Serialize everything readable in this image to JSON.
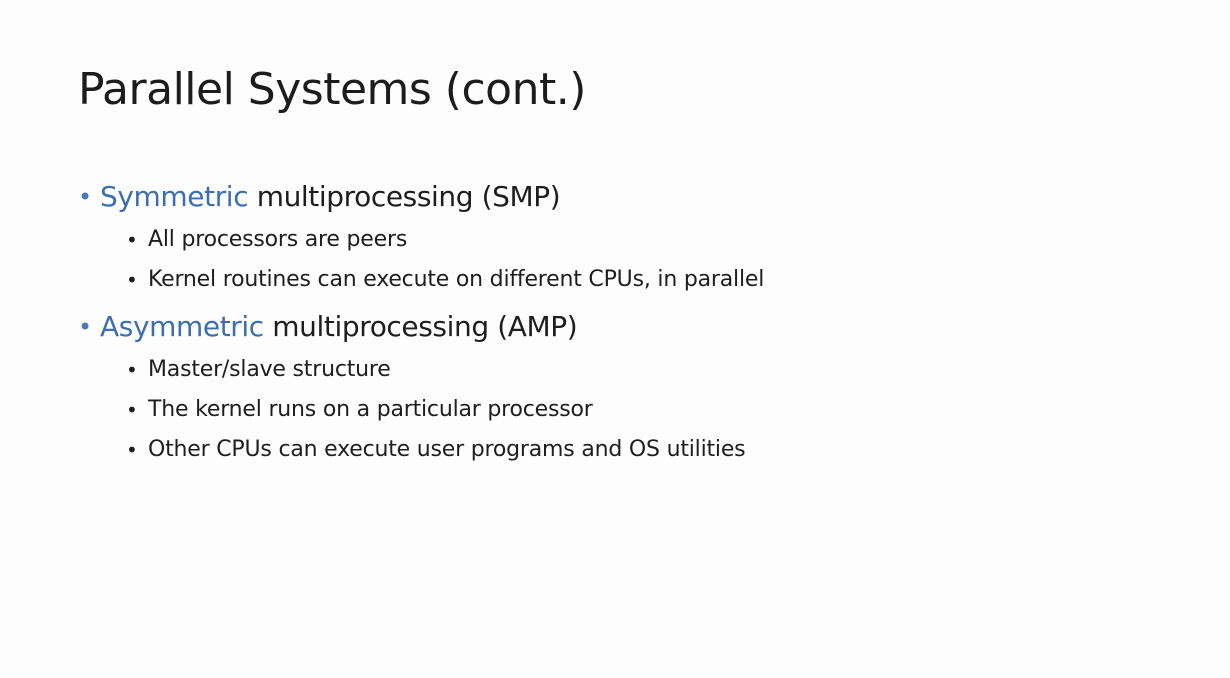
{
  "slide": {
    "title": "Parallel Systems (cont.)",
    "bullet_char": "•",
    "accent_color": "#3c6fae",
    "items": [
      {
        "highlight": "Symmetric",
        "rest": " multiprocessing (SMP)",
        "subitems": [
          "All processors are peers",
          "Kernel routines can execute on different CPUs, in parallel"
        ]
      },
      {
        "highlight": "Asymmetric",
        "rest": " multiprocessing (AMP)",
        "subitems": [
          "Master/slave structure",
          "The kernel runs on a particular processor",
          "Other CPUs can execute user programs and OS utilities"
        ]
      }
    ]
  }
}
